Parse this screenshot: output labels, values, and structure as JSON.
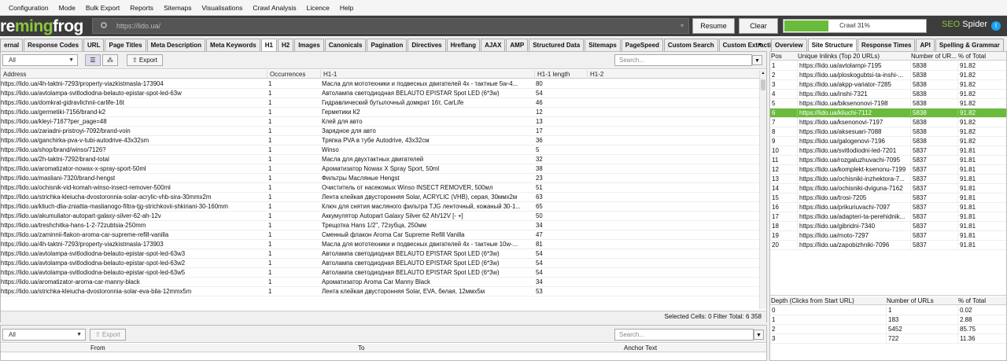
{
  "menu": [
    "Configuration",
    "Mode",
    "Bulk Export",
    "Reports",
    "Sitemaps",
    "Visualisations",
    "Crawl Analysis",
    "Licence",
    "Help"
  ],
  "logo": {
    "part1": "re",
    "part2": "ming",
    "part3": "frog"
  },
  "url_bar": {
    "value": "https://lido.ua/",
    "clear_glyph": "×",
    "dropdown_glyph": "▾"
  },
  "buttons": {
    "resume": "Resume",
    "clear": "Clear"
  },
  "crawl_progress": {
    "label": "Crawl 31%",
    "fraction": 0.31
  },
  "brand": {
    "seo": "SEO",
    "spider": " Spider"
  },
  "left_tabs": [
    "ernal",
    "Response Codes",
    "URL",
    "Page Titles",
    "Meta Description",
    "Meta Keywords",
    "H1",
    "H2",
    "Images",
    "Canonicals",
    "Pagination",
    "Directives",
    "Hreflang",
    "AJAX",
    "AMP",
    "Structured Data",
    "Sitemaps",
    "PageSpeed",
    "Custom Search",
    "Custom Extraction"
  ],
  "left_tab_active": "H1",
  "left_tab_overflow": "▾",
  "filter": {
    "value": "All",
    "export_label": "Export",
    "search_placeholder": "Search..."
  },
  "grid": {
    "columns": [
      "Address",
      "Occurrences",
      "H1-1",
      "H1-1 length",
      "H1-2"
    ],
    "rows": [
      [
        "https://lido.ua/4h-taktni-7293/property-viazkistmasla-173904",
        "1",
        "Масла для мототехники и подвесных двигателей 4х - тактные 5w-4...",
        "80"
      ],
      [
        "https://lido.ua/avtolampa-svitlodiodna-belauto-epistar-spot-led-63w",
        "1",
        "Автолампа светодиодная BELAUTO EPISTAR Spot LED (6*3w)",
        "54"
      ],
      [
        "https://lido.ua/domkrat-gidravlichnii-carlife-16t",
        "1",
        "Гидравлический бутылочный домкрат 16т, CarLife",
        "46"
      ],
      [
        "https://lido.ua/germetiki-7156/brand-k2",
        "1",
        "Герметики К2",
        "12"
      ],
      [
        "https://lido.ua/kleyi-7167?per_page=48",
        "1",
        "Клей для авто",
        "13"
      ],
      [
        "https://lido.ua/zariadni-pristroyi-7092/brand-voin",
        "1",
        "Зарядное для авто",
        "17"
      ],
      [
        "https://lido.ua/ganchirka-pva-v-tubi-autodrive-43x32sm",
        "1",
        "Тряпка PVA в тубе Autodrive, 43х32см",
        "36"
      ],
      [
        "https://lido.ua/shop/brand/winso/7126?",
        "1",
        "Winso",
        "5"
      ],
      [
        "https://lido.ua/2h-taktni-7292/brand-total",
        "1",
        "Масла для двухтактных двигателей",
        "32"
      ],
      [
        "https://lido.ua/aromatizator-nowax-x-spray-sport-50ml",
        "1",
        "Ароматизатор Nowax X Spray Sport, 50ml",
        "38"
      ],
      [
        "https://lido.ua/masliani-7320/brand-hengst",
        "1",
        "Фильтры Масляные Hengst",
        "23"
      ],
      [
        "https://lido.ua/ochisnik-vid-komah-winso-insect-remover-500ml",
        "1",
        "Очиститель от насекомых Winso INSECT REMOVER, 500мл",
        "51"
      ],
      [
        "https://lido.ua/strichka-kleiucha-dvostoronnia-solar-acrylic-vhb-sira-30mmx2m",
        "1",
        "Лента клейкая двусторонняя Solar, ACRYLIC (VHB), серая, 30ммх2м",
        "63"
      ],
      [
        "https://lido.ua/kliuch-dlia-zniattia-maslianogo-filtra-tjg-strichkovii-shkiriani-30-160mm",
        "1",
        "Ключ для снятия масляного фильтра TJG ленточный, кожаный 30-1...",
        "65"
      ],
      [
        "https://lido.ua/akumuliator-autopart-galaxy-silver-62-ah-12v",
        "1",
        "Аккумулятор Autopart Galaxy Silver 62 Ah/12V [- +]",
        "50"
      ],
      [
        "https://lido.ua/treshchitka-hans-1-2-72zubtsia-250mm",
        "1",
        "Трещотка Hans 1/2\", 72зубца, 250мм",
        "34"
      ],
      [
        "https://lido.ua/zaminnii-flakon-aroma-car-supreme-refill-vanilla",
        "1",
        "Сменный флакон Aroma Car Supreme Refill Vanilla",
        "47"
      ],
      [
        "https://lido.ua/4h-taktni-7293/property-viazkistmasla-173903",
        "1",
        "Масла для мототехники и подвесных двигателей 4х - тактные 10w-...",
        "81"
      ],
      [
        "https://lido.ua/avtolampa-svitlodiodna-belauto-epistar-spot-led-63w3",
        "1",
        "Автолампа светодиодная BELAUTO EPISTAR Spot LED (6*3w)",
        "54"
      ],
      [
        "https://lido.ua/avtolampa-svitlodiodna-belauto-epistar-spot-led-63w2",
        "1",
        "Автолампа светодиодная BELAUTO EPISTAR Spot LED (6*3w)",
        "54"
      ],
      [
        "https://lido.ua/avtolampa-svitlodiodna-belauto-epistar-spot-led-63w5",
        "1",
        "Автолампа светодиодная BELAUTO EPISTAR Spot LED (6*3w)",
        "54"
      ],
      [
        "https://lido.ua/aromatizator-aroma-car-manny-black",
        "1",
        "Ароматизатор Aroma Car Manny Black",
        "34"
      ],
      [
        "https://lido.ua/strichka-kleiucha-dvostoronnia-solar-eva-bila-12mmx5m",
        "1",
        "Лента клейкая двусторонняя Solar, EVA, белая, 12ммх5м",
        "53"
      ]
    ]
  },
  "status_bar": "Selected Cells: 0  Filter Total: 6 358",
  "bottom": {
    "filter": "All",
    "export_label": "Export",
    "search_placeholder": "Search...",
    "columns": [
      "From",
      "To",
      "Anchor Text"
    ]
  },
  "right_tabs": [
    "Overview",
    "Site Structure",
    "Response Times",
    "API",
    "Spelling & Grammar"
  ],
  "right_tab_active": "Site Structure",
  "inlinks_table": {
    "columns": [
      "Pos",
      "Unique Inlinks (Top 20 URLs)",
      "Number of UR...",
      "% of Total"
    ],
    "rows": [
      [
        "1",
        "https://lido.ua/avtolampi-7195",
        "5838",
        "91.82"
      ],
      [
        "2",
        "https://lido.ua/ploskogubtsi-ta-inshi-...",
        "5838",
        "91.82"
      ],
      [
        "3",
        "https://lido.ua/akpp-variator-7285",
        "5838",
        "91.82"
      ],
      [
        "4",
        "https://lido.ua/inshi-7321",
        "5838",
        "91.82"
      ],
      [
        "5",
        "https://lido.ua/biksenonovi-7198",
        "5838",
        "91.82"
      ],
      [
        "6",
        "https://lido.ua/kliuchi-7112",
        "5838",
        "91.82"
      ],
      [
        "7",
        "https://lido.ua/ksenonovi-7197",
        "5838",
        "91.82"
      ],
      [
        "8",
        "https://lido.ua/aksesuari-7088",
        "5838",
        "91.82"
      ],
      [
        "9",
        "https://lido.ua/galogenovi-7196",
        "5838",
        "91.82"
      ],
      [
        "10",
        "https://lido.ua/svitlodiodni-led-7201",
        "5837",
        "91.81"
      ],
      [
        "11",
        "https://lido.ua/rozgaluzhuvachi-7095",
        "5837",
        "91.81"
      ],
      [
        "12",
        "https://lido.ua/komplekt-ksenonu-7199",
        "5837",
        "91.81"
      ],
      [
        "13",
        "https://lido.ua/ochisniki-inzhektora-7...",
        "5837",
        "91.81"
      ],
      [
        "14",
        "https://lido.ua/ochisniki-dviguna-7162",
        "5837",
        "91.81"
      ],
      [
        "15",
        "https://lido.ua/trosi-7205",
        "5837",
        "91.81"
      ],
      [
        "16",
        "https://lido.ua/prikuriuvachi-7097",
        "5837",
        "91.81"
      ],
      [
        "17",
        "https://lido.ua/adapteri-ta-perehidnik...",
        "5837",
        "91.81"
      ],
      [
        "18",
        "https://lido.ua/gibridni-7340",
        "5837",
        "91.81"
      ],
      [
        "19",
        "https://lido.ua/moto-7297",
        "5837",
        "91.81"
      ],
      [
        "20",
        "https://lido.ua/zapobizhniki-7096",
        "5837",
        "91.81"
      ]
    ],
    "selected_index": 5
  },
  "depth_table": {
    "columns": [
      "Depth (Clicks from Start URL)",
      "Number of URLs",
      "% of Total"
    ],
    "rows": [
      [
        "0",
        "1",
        "0.02"
      ],
      [
        "1",
        "183",
        "2.88"
      ],
      [
        "2",
        "5452",
        "85.75"
      ],
      [
        "3",
        "722",
        "11.36"
      ]
    ]
  },
  "colors": {
    "accent_green": "#6abb3b",
    "topbar": "#3c3c3c"
  }
}
